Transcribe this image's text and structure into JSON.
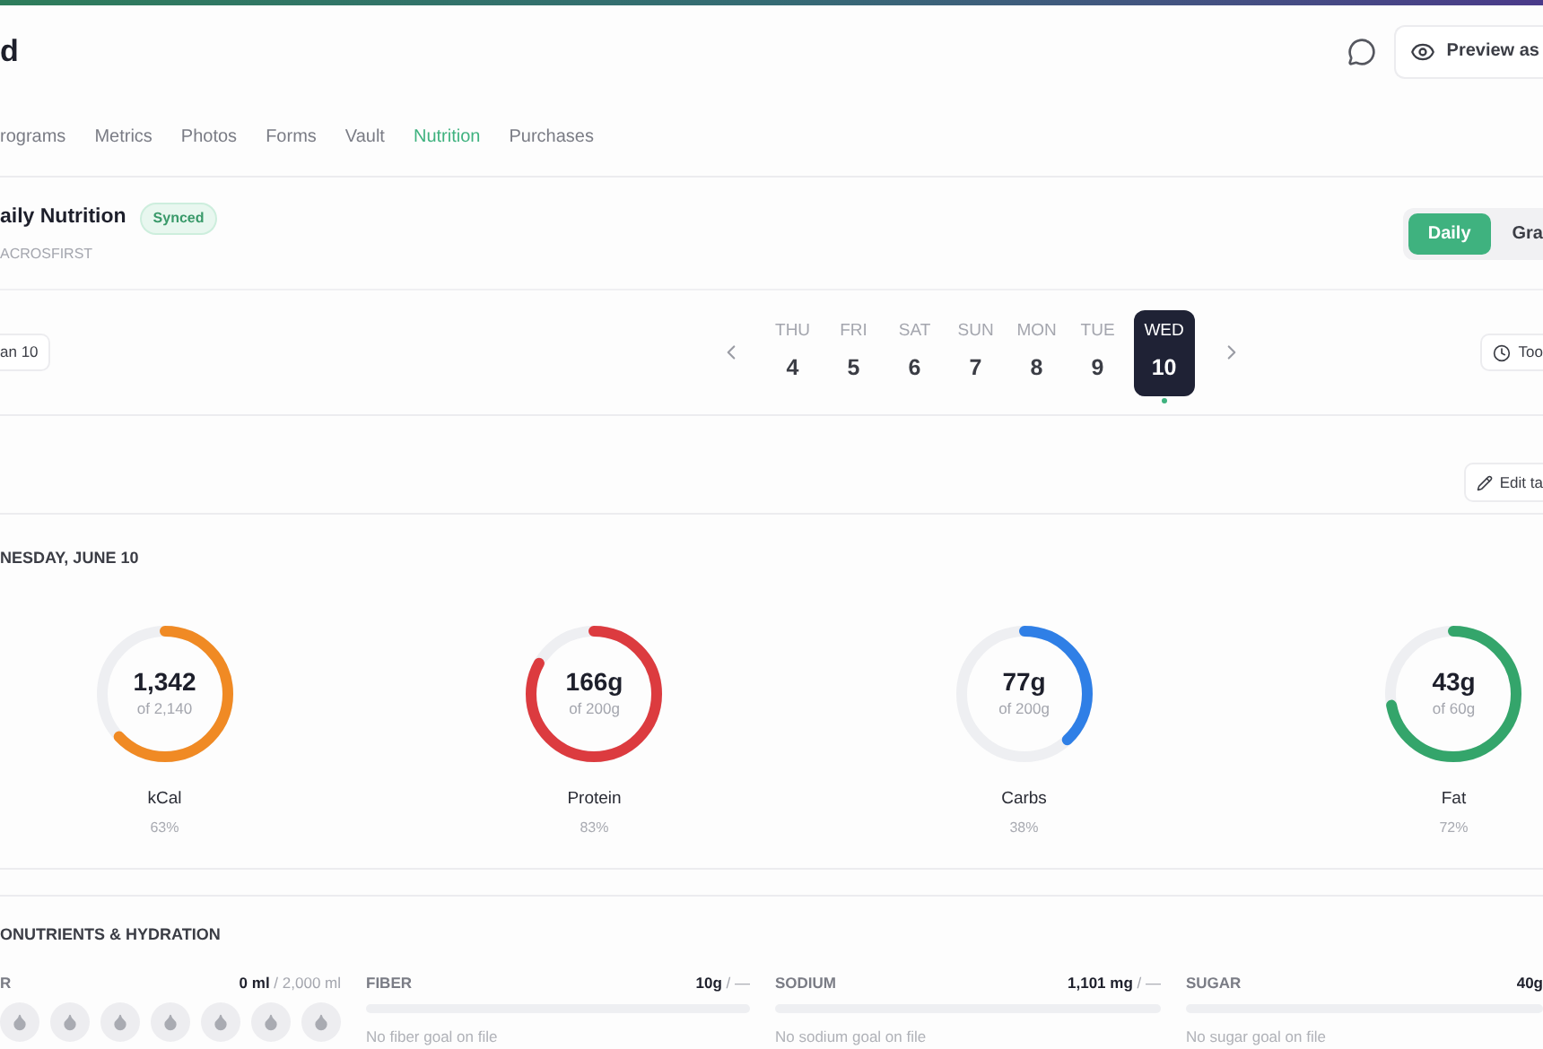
{
  "header": {
    "title": "d",
    "preview_button": "Preview as"
  },
  "tabs": [
    {
      "label": "rograms",
      "selected": false
    },
    {
      "label": "Metrics",
      "selected": false
    },
    {
      "label": "Photos",
      "selected": false
    },
    {
      "label": "Forms",
      "selected": false
    },
    {
      "label": "Vault",
      "selected": false
    },
    {
      "label": "Nutrition",
      "selected": true
    },
    {
      "label": "Purchases",
      "selected": false
    }
  ],
  "card": {
    "title": "aily Nutrition",
    "badge": "Synced",
    "subtitle": "ACROSFIRST",
    "views": [
      {
        "label": "Daily",
        "selected": true
      },
      {
        "label": "Gra",
        "selected": false
      }
    ]
  },
  "date_nav": {
    "left_button": "an 10",
    "right_button": "Too",
    "days": [
      {
        "day": "THU",
        "date": "4",
        "selected": false,
        "logged": false
      },
      {
        "day": "FRI",
        "date": "5",
        "selected": false,
        "logged": false
      },
      {
        "day": "SAT",
        "date": "6",
        "selected": false,
        "logged": false
      },
      {
        "day": "SUN",
        "date": "7",
        "selected": false,
        "logged": false
      },
      {
        "day": "MON",
        "date": "8",
        "selected": false,
        "logged": false
      },
      {
        "day": "TUE",
        "date": "9",
        "selected": false,
        "logged": false
      },
      {
        "day": "WED",
        "date": "10",
        "selected": true,
        "logged": true
      }
    ]
  },
  "edit_button": "Edit ta",
  "day_heading": "NESDAY, JUNE 10",
  "macros": [
    {
      "value": "1,342",
      "goal": "of 2,140",
      "label": "kCal",
      "percent": "63%",
      "color": "#f08a24"
    },
    {
      "value": "166g",
      "goal": "of 200g",
      "label": "Protein",
      "percent": "83%",
      "color": "#dc3b3f"
    },
    {
      "value": "77g",
      "goal": "of 200g",
      "label": "Carbs",
      "percent": "38%",
      "color": "#2f7fe6"
    },
    {
      "value": "43g",
      "goal": "of 60g",
      "label": "Fat",
      "percent": "72%",
      "color": "#34a56b"
    }
  ],
  "micro_heading": "ONUTRIENTS & HYDRATION",
  "micros": [
    {
      "kind": "water",
      "name": "R",
      "amount": "0 ml",
      "goal": " / 2,000 ml",
      "glasses": [
        {
          "filled": false
        },
        {
          "filled": false
        },
        {
          "filled": false
        },
        {
          "filled": false
        },
        {
          "filled": false
        },
        {
          "filled": false
        },
        {
          "filled": false
        }
      ]
    },
    {
      "kind": "bar",
      "name": "FIBER",
      "amount": "10g",
      "goal": " / —",
      "note": "No fiber goal on file"
    },
    {
      "kind": "bar",
      "name": "SODIUM",
      "amount": "1,101 mg",
      "goal": " / —",
      "note": "No sodium goal on file"
    },
    {
      "kind": "bar",
      "name": "SUGAR",
      "amount": "40g",
      "note": "No sugar goal on file"
    }
  ]
}
